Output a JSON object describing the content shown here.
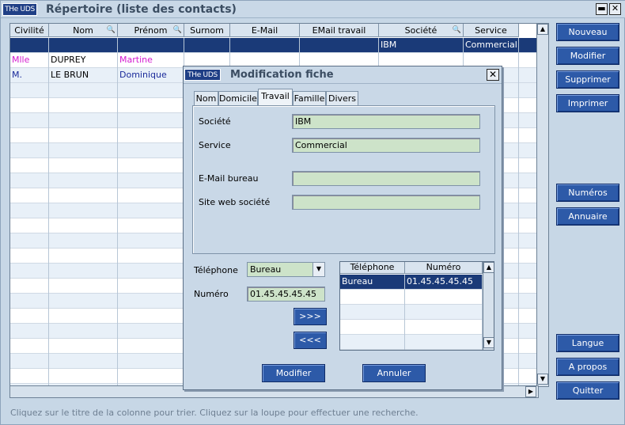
{
  "window": {
    "logo": "THe UDS",
    "title": "Répertoire (liste des contacts)"
  },
  "grid": {
    "columns": [
      "Civilité",
      "Nom",
      "Prénom",
      "Surnom",
      "E-Mail",
      "EMail travail",
      "Société",
      "Service"
    ],
    "selected_row": {
      "societe": "IBM",
      "service": "Commercial"
    },
    "rows": [
      {
        "civilite": "Mlle",
        "nom": "DUPREY",
        "prenom": "Martine"
      },
      {
        "civilite": "M.",
        "nom": "LE BRUN",
        "prenom": "Dominique"
      }
    ]
  },
  "right_buttons": {
    "nouveau": "Nouveau",
    "modifier": "Modifier",
    "supprimer": "Supprimer",
    "imprimer": "Imprimer",
    "numeros": "Numéros",
    "annuaire": "Annuaire",
    "langue": "Langue",
    "apropos": "A propos",
    "quitter": "Quitter"
  },
  "status_hint": "Cliquez sur le titre de la colonne pour trier. Cliquez sur la loupe pour effectuer une recherche.",
  "dialog": {
    "logo": "THe UDS",
    "title": "Modification fiche",
    "tabs": [
      "Nom",
      "Domicile",
      "Travail",
      "Famille",
      "Divers"
    ],
    "active_tab": "Travail",
    "fields": {
      "societe_label": "Société",
      "societe_value": "IBM",
      "service_label": "Service",
      "service_value": "Commercial",
      "email_label": "E-Mail bureau",
      "email_value": "",
      "site_label": "Site web société",
      "site_value": ""
    },
    "telephone_label": "Téléphone",
    "telephone_type": "Bureau",
    "numero_label": "Numéro",
    "numero_value": "01.45.45.45.45",
    "add_button": ">>>",
    "remove_button": "<<<",
    "phone_table": {
      "headers": [
        "Téléphone",
        "Numéro"
      ],
      "rows": [
        {
          "type": "Bureau",
          "numero": "01.45.45.45.45"
        }
      ]
    },
    "modify_button": "Modifier",
    "cancel_button": "Annuler"
  }
}
